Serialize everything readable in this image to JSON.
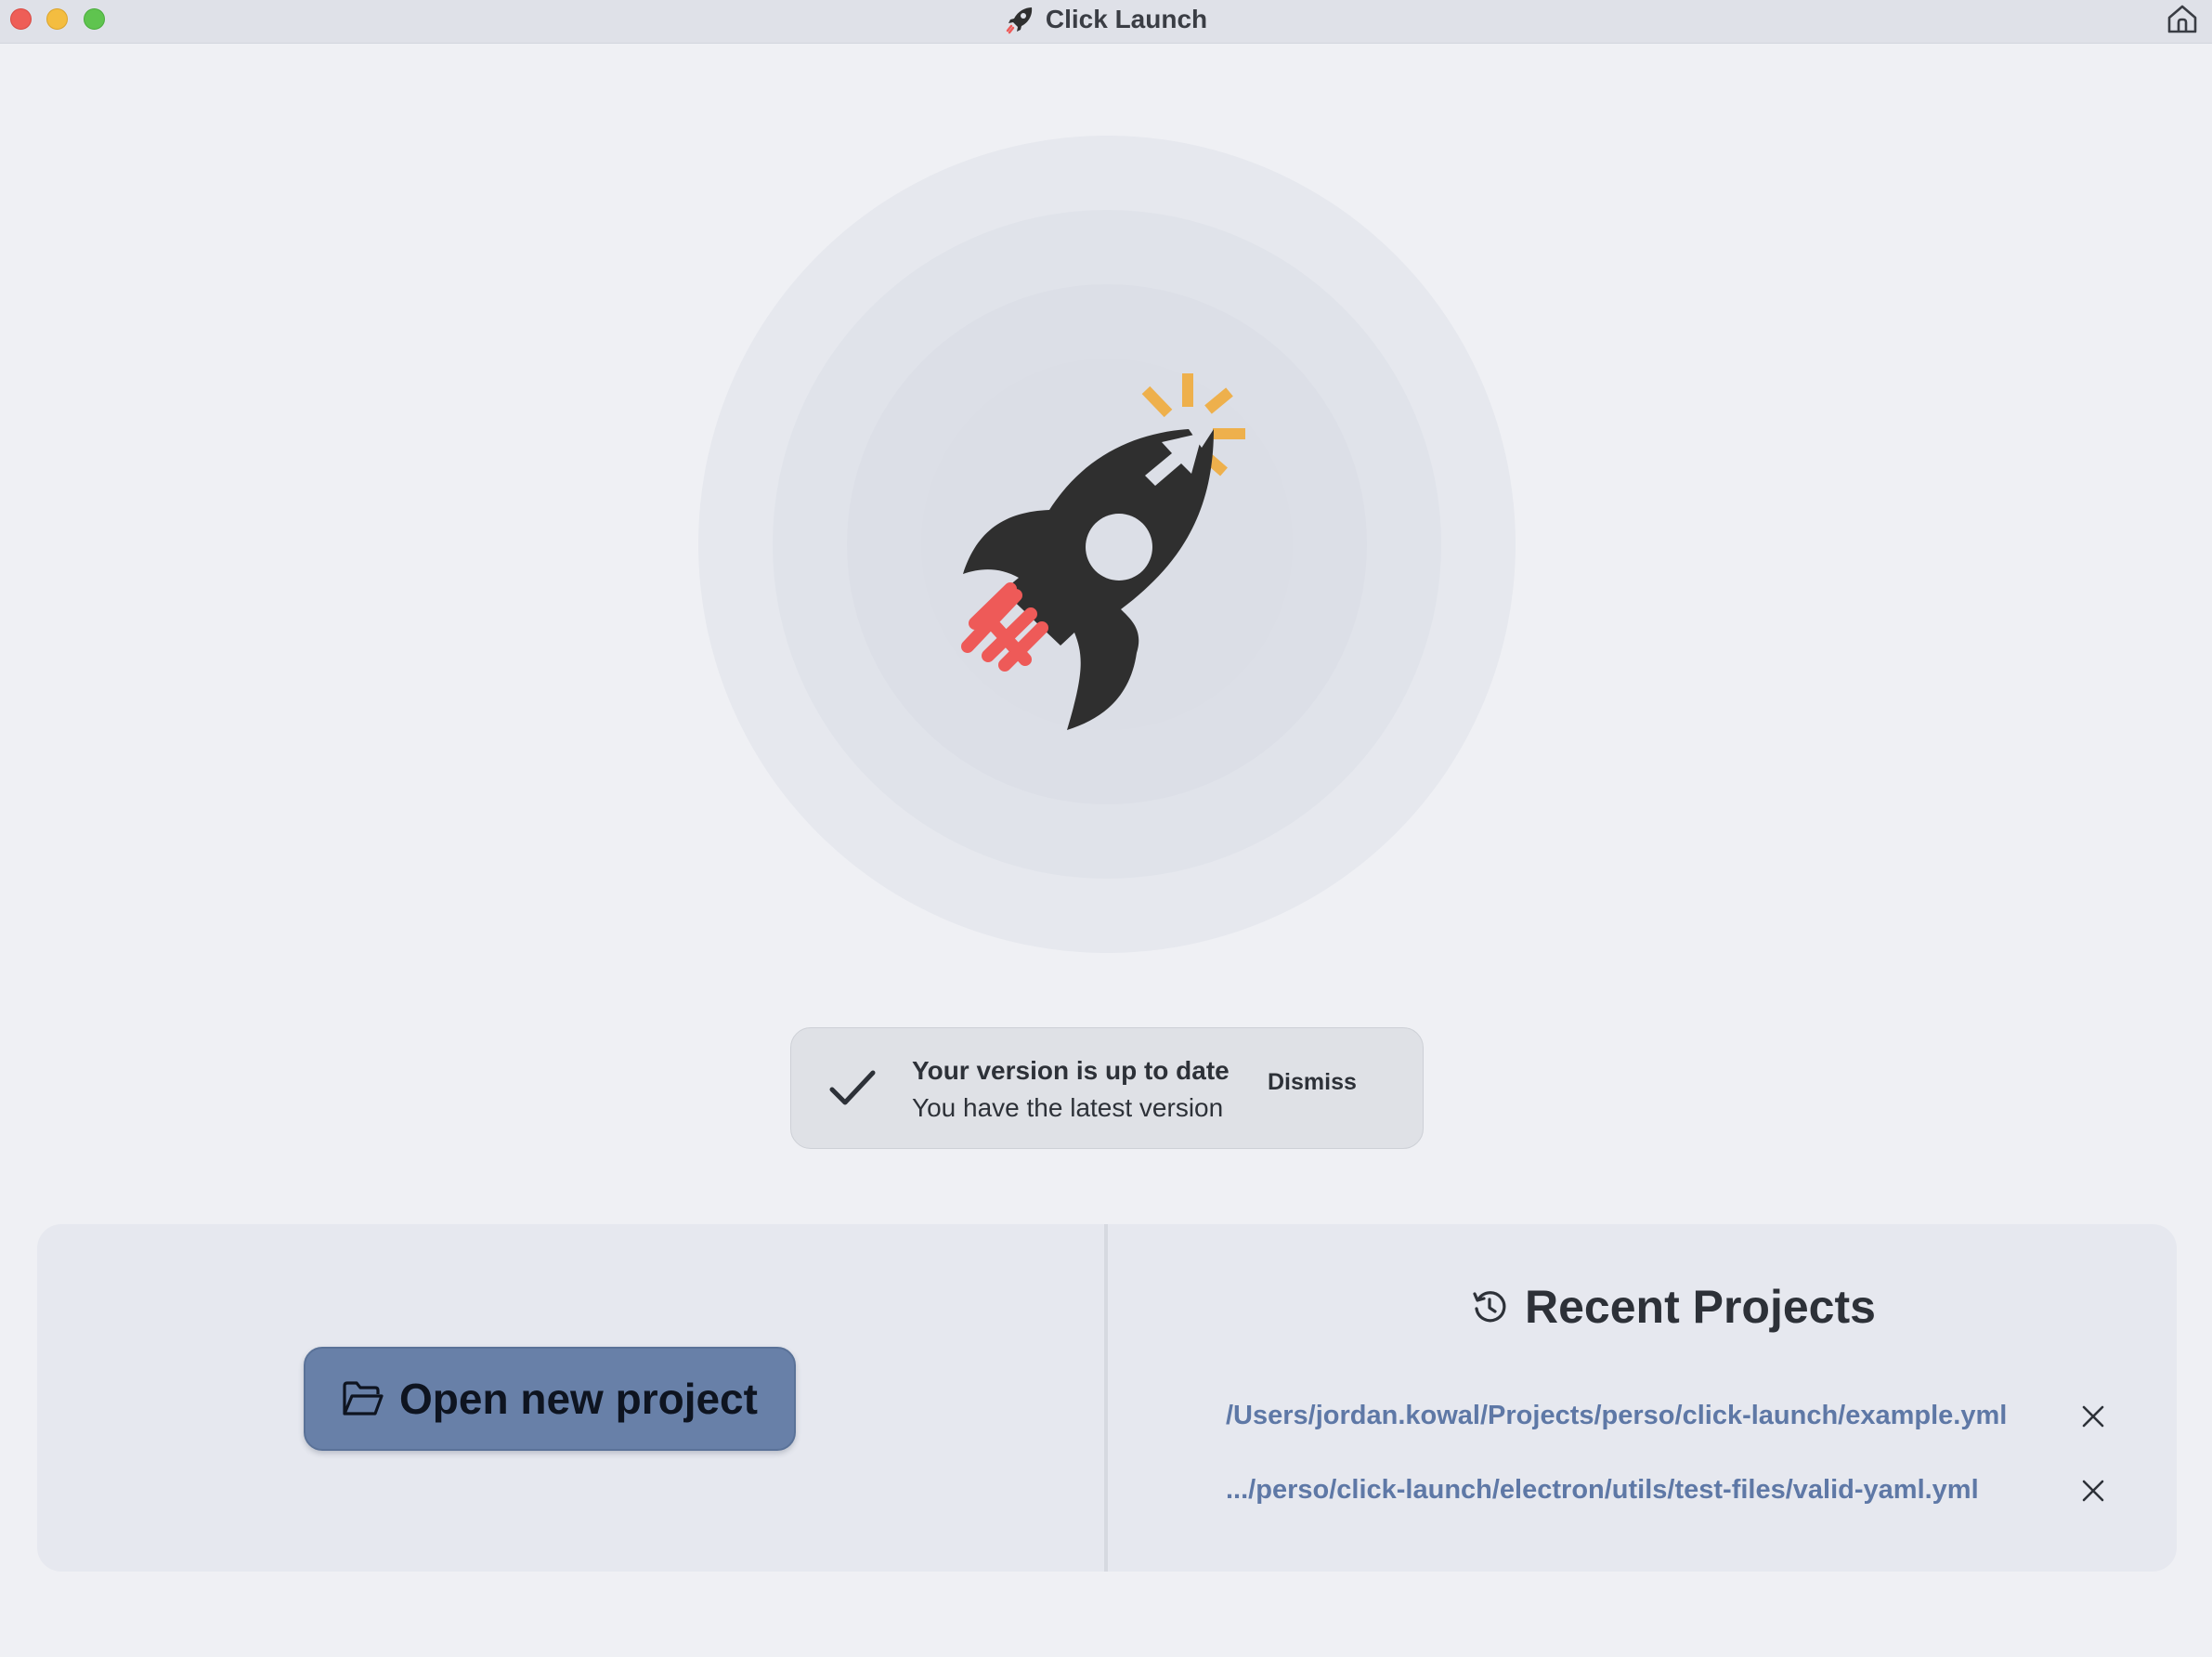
{
  "window": {
    "title": "Click Launch",
    "icons": {
      "app": "rocket-icon",
      "home": "home-icon"
    }
  },
  "hero": {
    "logo": "rocket-cursor-logo",
    "colors": {
      "rocket": "#2f2f2f",
      "flame": "#ee5a58",
      "sparks": "#eeb04c"
    }
  },
  "notice": {
    "icon": "checkmark-icon",
    "title": "Your version is up to date",
    "subtitle": "You have the latest version",
    "dismiss_label": "Dismiss"
  },
  "actions": {
    "open_label": "Open new project",
    "open_icon": "folder-open-icon",
    "button_color": "#6880a8"
  },
  "recent": {
    "heading": "Recent Projects",
    "heading_icon": "history-icon",
    "items": [
      {
        "path": "/Users/jordan.kowal/Projects/perso/click-launch/example.yml",
        "remove_icon": "close-icon"
      },
      {
        "path": ".../perso/click-launch/electron/utils/test-files/valid-yaml.yml",
        "remove_icon": "close-icon"
      }
    ],
    "link_color": "#5e78a6"
  }
}
